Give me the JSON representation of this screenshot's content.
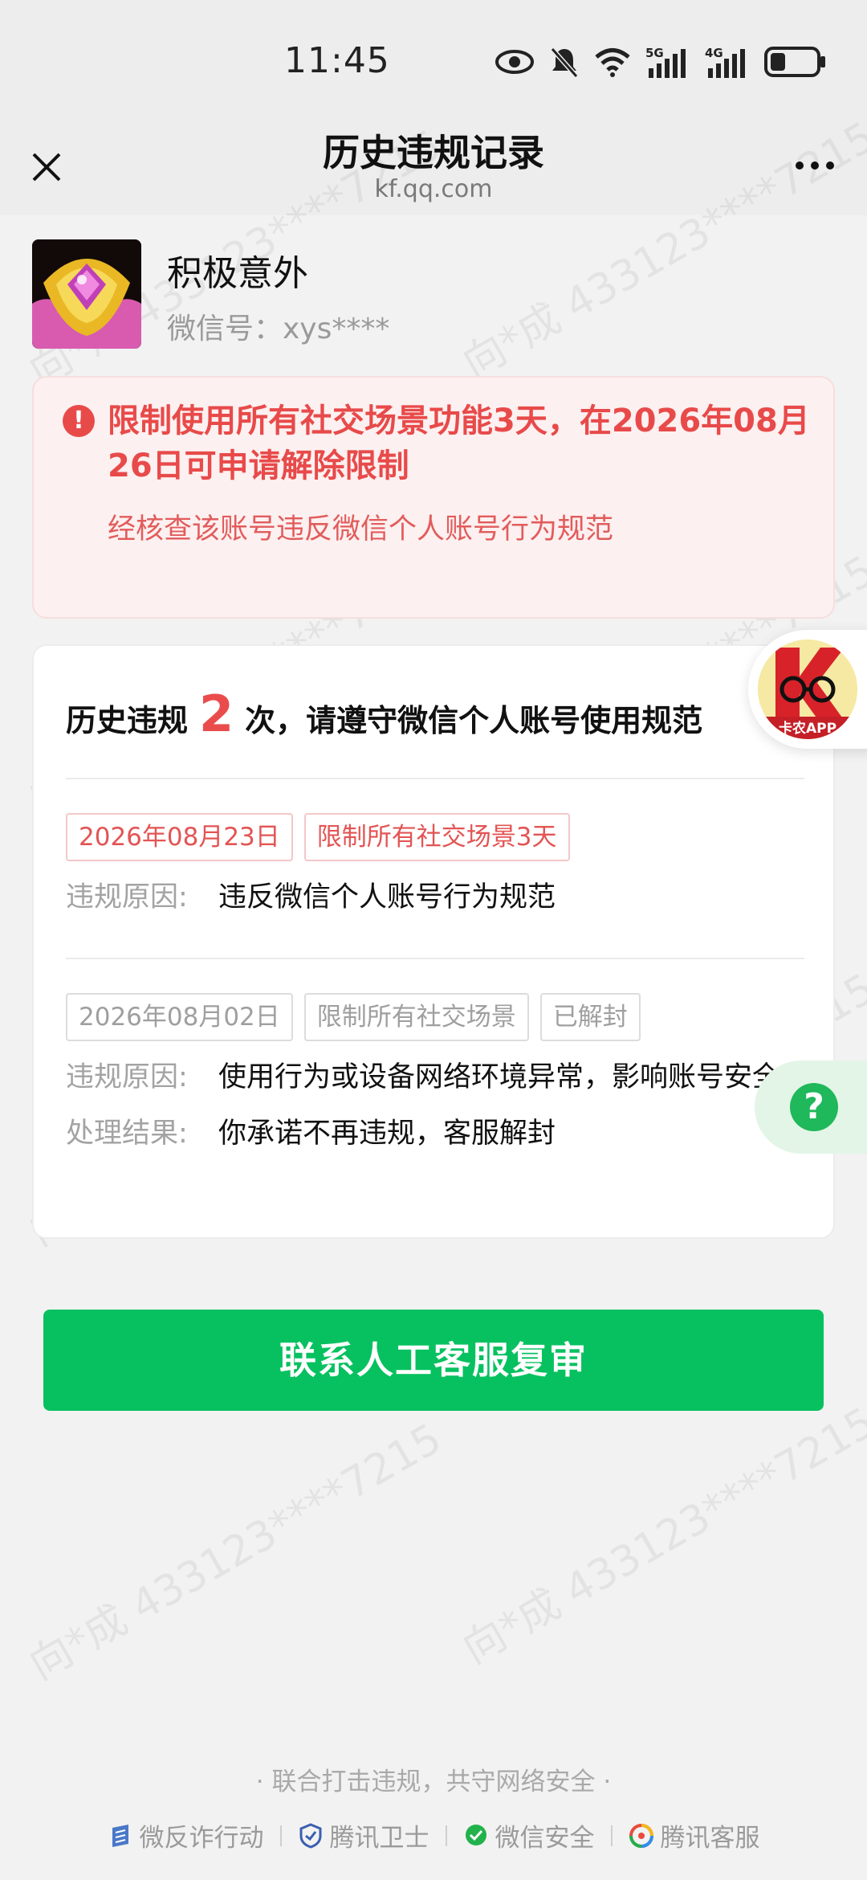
{
  "status_bar": {
    "time": "11:45",
    "net1": "5G",
    "net2": "4G"
  },
  "nav": {
    "title": "历史违规记录",
    "subtitle": "kf.qq.com",
    "close_icon": "close-icon",
    "more_icon": "more-icon"
  },
  "watermark": "向*成 433123****7215",
  "profile": {
    "name": "积极意外",
    "wechat_id": "微信号：xys****"
  },
  "alert": {
    "icon_glyph": "!",
    "title": "限制使用所有社交场景功能3天，在2026年08月26日可申请解除限制",
    "description": "经核查该账号违反微信个人账号行为规范",
    "color": "#e84a4a"
  },
  "history": {
    "prefix": "历史违规",
    "count": "2",
    "suffix": "次，请遵守微信个人账号使用规范",
    "records": [
      {
        "date": "2026年08月23日",
        "restriction": "限制所有社交场景3天",
        "reason_label": "违规原因:",
        "reason": "违反微信个人账号行为规范"
      },
      {
        "date": "2026年08月02日",
        "restriction": "限制所有社交场景",
        "status": "已解封",
        "reason_label": "违规原因:",
        "reason": "使用行为或设备网络环境异常，影响账号安全",
        "result_label": "处理结果:",
        "result": "你承诺不再违规，客服解封"
      }
    ]
  },
  "floating": {
    "app_badge_text": "卡农APP",
    "help_glyph": "?"
  },
  "primary_button": "联系人工客服复审",
  "footer": {
    "slogan": "· 联合打击违规，共守网络安全 ·",
    "links": [
      "微反诈行动",
      "腾讯卫士",
      "微信安全",
      "腾讯客服"
    ]
  },
  "colors": {
    "accent_green": "#07c160",
    "alert_red": "#e84a4a",
    "page_bg": "#f2f2f2"
  }
}
